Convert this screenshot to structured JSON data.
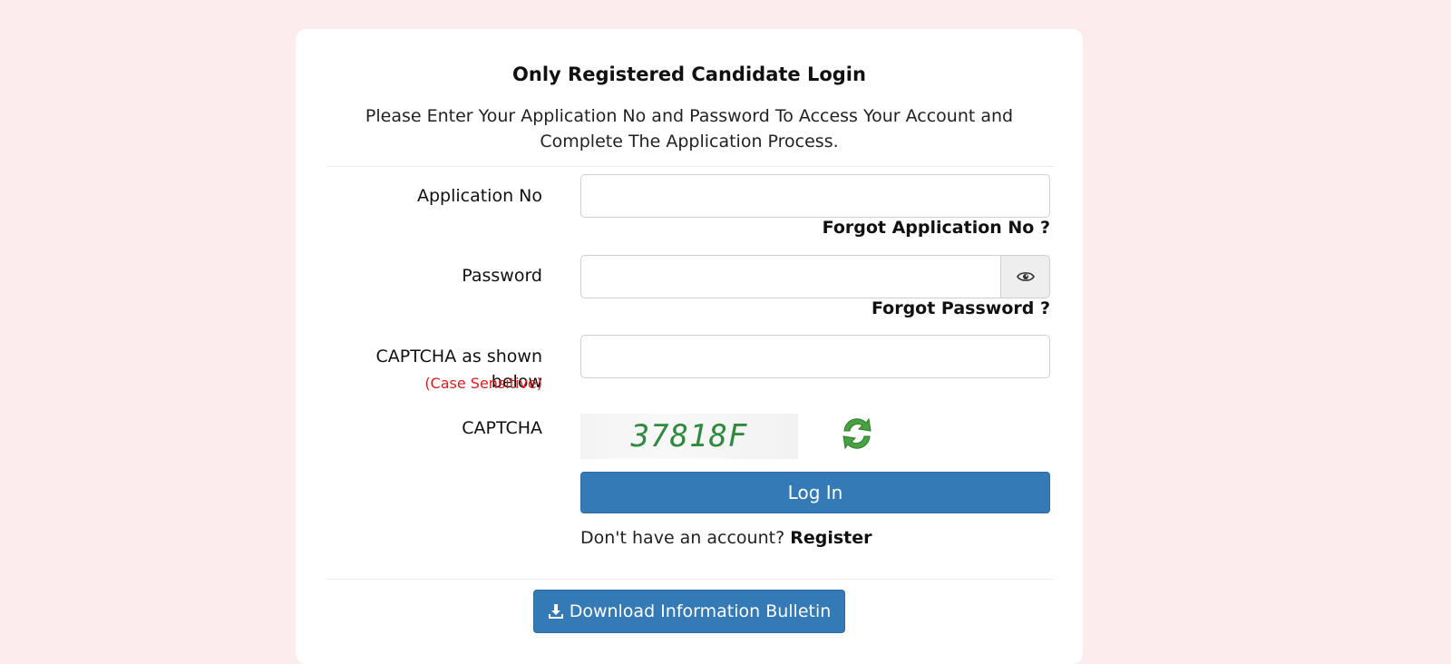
{
  "login": {
    "title": "Only Registered Candidate Login",
    "subtitle": "Please Enter Your Application No and Password To Access Your Account and Complete The Application Process.",
    "application_no_label": "Application No",
    "application_no_value": "",
    "forgot_application_no": "Forgot Application No ?",
    "password_label": "Password",
    "password_value": "",
    "forgot_password": "Forgot Password ?",
    "captcha_input_label": "CAPTCHA as shown below",
    "captcha_case_note": "(Case Sensitive)",
    "captcha_input_value": "",
    "captcha_label": "CAPTCHA",
    "captcha_text": "37818F",
    "login_button": "Log In",
    "no_account_text": "Don't have an account?",
    "register_link": "Register",
    "download_button": "Download Information Bulletin"
  },
  "colors": {
    "page_background": "#fdeced",
    "primary_button": "#337ab7",
    "case_sensitive_note": "#e01b1b",
    "captcha_text": "#2f8a3f"
  },
  "icons": {
    "password_toggle": "eye-icon",
    "captcha_refresh": "refresh-icon",
    "download": "download-icon"
  }
}
